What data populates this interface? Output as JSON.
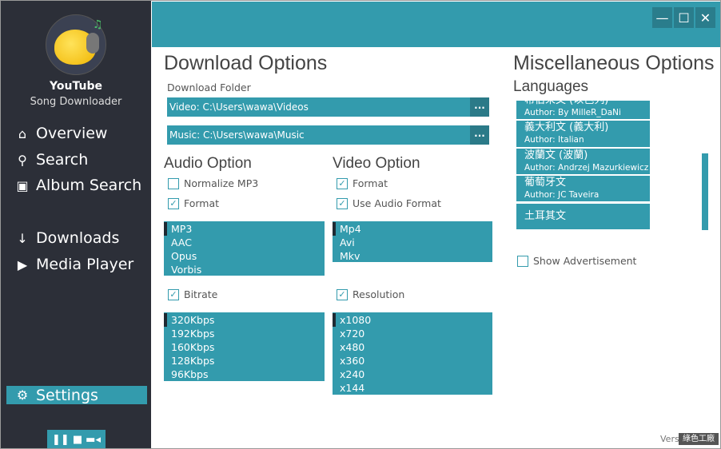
{
  "app": {
    "name": "YouTube",
    "subtitle": "Song Downloader"
  },
  "nav": [
    {
      "icon": "home-icon",
      "label": "Overview"
    },
    {
      "icon": "search-icon",
      "label": "Search"
    },
    {
      "icon": "album-icon",
      "label": "Album Search"
    },
    {
      "icon": "download-icon",
      "label": "Downloads"
    },
    {
      "icon": "play-icon",
      "label": "Media Player"
    },
    {
      "icon": "gear-icon",
      "label": "Settings",
      "selected": true
    }
  ],
  "player_controls": [
    "pause-icon",
    "stop-icon",
    "video-camera-icon"
  ],
  "window_buttons": [
    "minimize",
    "maximize",
    "close"
  ],
  "download": {
    "title": "Download Options",
    "folder_label": "Download Folder",
    "video_path": "Video: C:\\Users\\wawa\\Videos",
    "music_path": "Music: C:\\Users\\wawa\\Music",
    "browse": "..."
  },
  "audio": {
    "title": "Audio Option",
    "normalize": {
      "label": "Normalize MP3",
      "checked": false
    },
    "format": {
      "label": "Format",
      "checked": true
    },
    "formats": [
      "MP3",
      "AAC",
      "Opus",
      "Vorbis"
    ],
    "bitrate": {
      "label": "Bitrate",
      "checked": true
    },
    "bitrates": [
      "320Kbps",
      "192Kbps",
      "160Kbps",
      "128Kbps",
      "96Kbps"
    ]
  },
  "video": {
    "title": "Video Option",
    "format": {
      "label": "Format",
      "checked": true
    },
    "use_audio": {
      "label": "Use Audio Format",
      "checked": true
    },
    "formats": [
      "Mp4",
      "Avi",
      "Mkv"
    ],
    "resolution": {
      "label": "Resolution",
      "checked": true
    },
    "resolutions": [
      "x1080",
      "x720",
      "x480",
      "x360",
      "x240",
      "x144"
    ]
  },
  "misc": {
    "title": "Miscellaneous Options",
    "languages_label": "Languages",
    "languages": [
      {
        "name": "希伯來文 (以色列)",
        "author": "Author: By MilleR_DaNi"
      },
      {
        "name": "義大利文 (義大利)",
        "author": "Author: Italian"
      },
      {
        "name": "波蘭文 (波蘭)",
        "author": "Author: Andrzej Mazurkiewicz"
      },
      {
        "name": "葡萄牙文",
        "author": "Author: JC Taveira"
      },
      {
        "name": "土耳其文",
        "author": ""
      }
    ],
    "show_ads": {
      "label": "Show Advertisement",
      "checked": false
    }
  },
  "version_text": "Versi",
  "watermark": "綠色工廠",
  "colors": {
    "accent": "#339bad",
    "sidebar": "#2c2f38",
    "button_dark": "#2a7d8c"
  }
}
